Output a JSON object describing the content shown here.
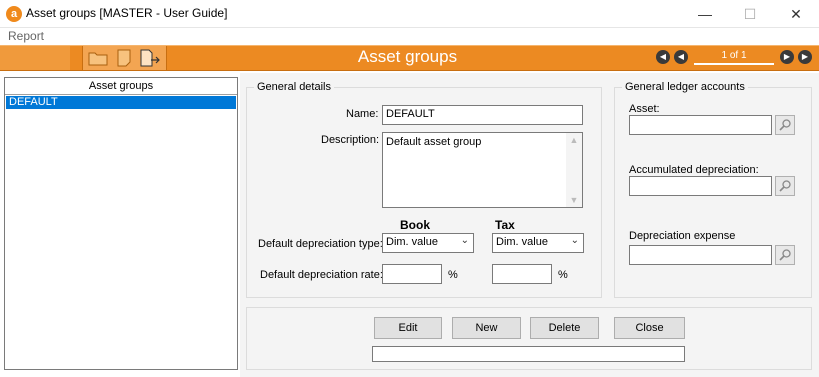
{
  "window": {
    "title": "Asset groups [MASTER - User Guide]",
    "icon_letter": "a",
    "minimize_glyph": "—",
    "maximize_glyph": "☐",
    "close_glyph": "✕"
  },
  "menu": {
    "items": [
      "Report"
    ]
  },
  "toolbar": {
    "title": "Asset groups",
    "icons": [
      "folder-icon",
      "note-icon",
      "export-icon"
    ],
    "nav": {
      "record_text": "1 of 1",
      "first": "first-record-icon",
      "prev": "previous-record-icon",
      "next": "next-record-icon",
      "last": "last-record-icon"
    }
  },
  "list": {
    "header": "Asset groups",
    "items": [
      "DEFAULT"
    ],
    "selected_index": 0
  },
  "general": {
    "title": "General details",
    "name_label": "Name:",
    "name_value": "DEFAULT",
    "description_label": "Description:",
    "description_value": "Default asset group",
    "book_header": "Book",
    "tax_header": "Tax",
    "dep_type_label": "Default depreciation type:",
    "book_type_value": "Dim. value",
    "tax_type_value": "Dim. value",
    "dep_rate_label": "Default depreciation rate:",
    "book_rate_value": "",
    "tax_rate_value": "",
    "percent": "%"
  },
  "ledger": {
    "title": "General ledger accounts",
    "asset_label": "Asset:",
    "asset_value": "",
    "accum_label": "Accumulated depreciation:",
    "accum_value": "",
    "expense_label": "Depreciation expense",
    "expense_value": ""
  },
  "buttons": {
    "edit": "Edit",
    "new": "New",
    "delete": "Delete",
    "close": "Close"
  },
  "status_text": "",
  "colors": {
    "toolbar": "#ec8a22",
    "selection": "#0078d7",
    "brand": "#f08a1c"
  }
}
